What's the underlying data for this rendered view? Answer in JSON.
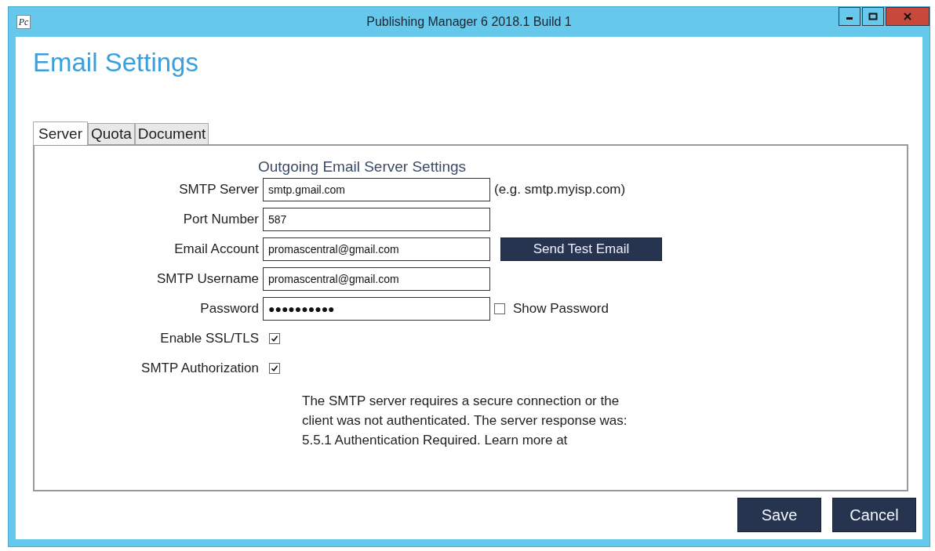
{
  "window": {
    "title": "Publishing Manager 6 2018.1 Build 1",
    "icon_text": "Pc"
  },
  "heading": "Email Settings",
  "tabs": [
    {
      "label": "Server",
      "selected": true
    },
    {
      "label": "Quota",
      "selected": false
    },
    {
      "label": "Document",
      "selected": false
    }
  ],
  "section_title": "Outgoing Email Server Settings",
  "fields": [
    {
      "label": "SMTP Server",
      "value": "smtp.gmail.com",
      "hint": "(e.g. smtp.myisp.com)"
    },
    {
      "label": "Port Number",
      "value": "587"
    },
    {
      "label": "Email Account",
      "value": "promascentral@gmail.com",
      "button": "Send Test Email"
    },
    {
      "label": "SMTP Username",
      "value": "promascentral@gmail.com"
    },
    {
      "label": "Password",
      "value": "●●●●●●●●●●",
      "option": {
        "label": "Show Password",
        "checked": false
      }
    }
  ],
  "checkboxes": [
    {
      "label": "Enable SSL/TLS",
      "checked": true
    },
    {
      "label": "SMTP Authorization",
      "checked": true
    }
  ],
  "message": "The SMTP server requires a secure connection or the client was not authenticated. The server response was: 5.5.1 Authentication Required. Learn more at",
  "buttons": [
    "Save",
    "Cancel"
  ]
}
